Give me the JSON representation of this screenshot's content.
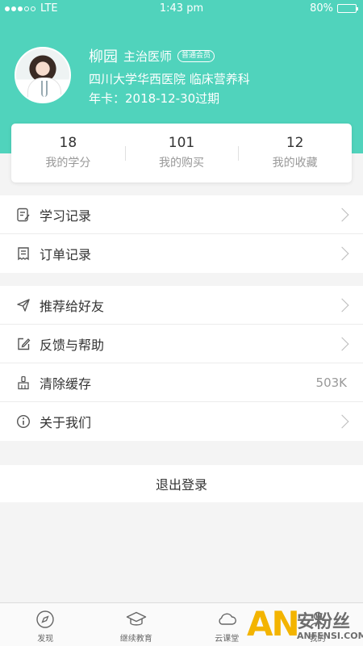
{
  "status_bar": {
    "carrier": "LTE",
    "time": "1:43 pm",
    "battery": "80%"
  },
  "profile": {
    "name": "柳园",
    "title": "主治医师",
    "member_badge": "普通会员",
    "hospital": "四川大学华西医院  临床营养科",
    "expiry": "年卡：2018-12-30过期"
  },
  "stats": [
    {
      "value": "18",
      "label": "我的学分"
    },
    {
      "value": "101",
      "label": "我的购买"
    },
    {
      "value": "12",
      "label": "我的收藏"
    }
  ],
  "menu_group_1": [
    {
      "label": "学习记录",
      "icon": "study-record-icon"
    },
    {
      "label": "订单记录",
      "icon": "order-record-icon"
    }
  ],
  "menu_group_2": [
    {
      "label": "推荐给好友",
      "icon": "send-icon"
    },
    {
      "label": "反馈与帮助",
      "icon": "edit-icon"
    },
    {
      "label": "清除缓存",
      "icon": "brush-icon",
      "value": "503K"
    },
    {
      "label": "关于我们",
      "icon": "info-icon"
    }
  ],
  "logout": "退出登录",
  "tabs": [
    {
      "label": "发现",
      "icon": "compass-icon"
    },
    {
      "label": "继续教育",
      "icon": "graduation-cap-icon"
    },
    {
      "label": "云课堂",
      "icon": "cloud-icon"
    },
    {
      "label": "我的",
      "icon": "user-icon"
    }
  ],
  "watermark": {
    "brand": "AN",
    "name": "安粉丝",
    "url": "ANFENSI.COM"
  },
  "colors": {
    "accent": "#50d3bc",
    "background": "#f4f4f4"
  }
}
